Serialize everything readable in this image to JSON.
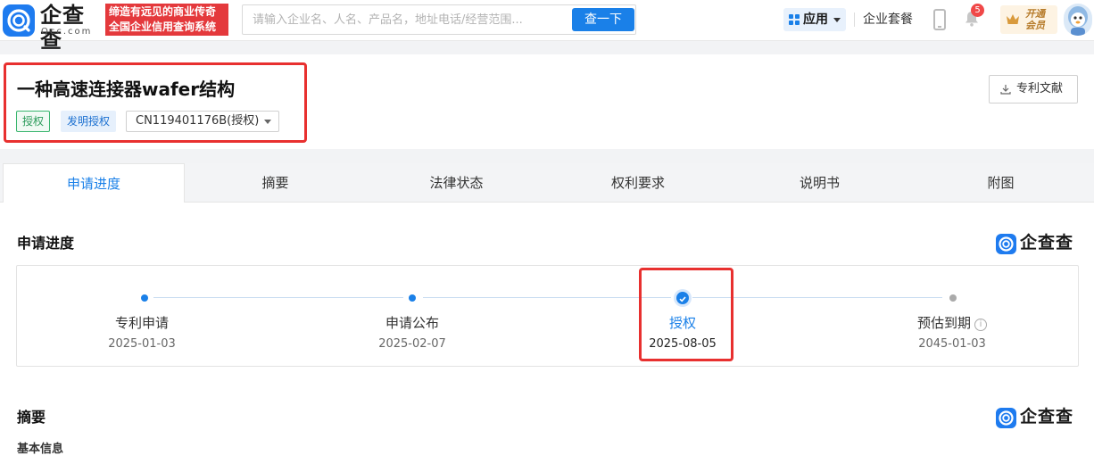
{
  "header": {
    "logo_text": "企查查",
    "logo_sub": "Qcc.com",
    "slogan_line1": "缔造有远见的商业传奇",
    "slogan_line2": "全国企业信用查询系统",
    "search_placeholder": "请输入企业名、人名、产品名，地址电话/经营范围...",
    "search_value": "",
    "search_button": "查一下",
    "apps_label": "应用",
    "combo_label": "企业套餐",
    "notification_count": "5",
    "vip_line1": "开通",
    "vip_line2": "会员",
    "colors": {
      "brand": "#1a80e8",
      "slogan_bg": "#e4393c"
    }
  },
  "patent": {
    "title": "一种高速连接器wafer结构",
    "status_tag": "授权",
    "type_tag": "发明授权",
    "publication_number": "CN119401176B(授权)",
    "doc_button": "专利文献"
  },
  "tabs": [
    {
      "label": "申请进度",
      "active": true
    },
    {
      "label": "摘要",
      "active": false
    },
    {
      "label": "法律状态",
      "active": false
    },
    {
      "label": "权利要求",
      "active": false
    },
    {
      "label": "说明书",
      "active": false
    },
    {
      "label": "附图",
      "active": false
    }
  ],
  "progress": {
    "title": "申请进度",
    "brand": "企查查",
    "steps": [
      {
        "label": "专利申请",
        "date": "2025-01-03",
        "state": "done"
      },
      {
        "label": "申请公布",
        "date": "2025-02-07",
        "state": "done"
      },
      {
        "label": "授权",
        "date": "2025-08-05",
        "state": "current"
      },
      {
        "label": "预估到期",
        "date": "2045-01-03",
        "state": "future"
      }
    ]
  },
  "abstract": {
    "title": "摘要",
    "brand": "企查查",
    "subtitle": "基本信息"
  },
  "highlight_color": "#e8302f"
}
